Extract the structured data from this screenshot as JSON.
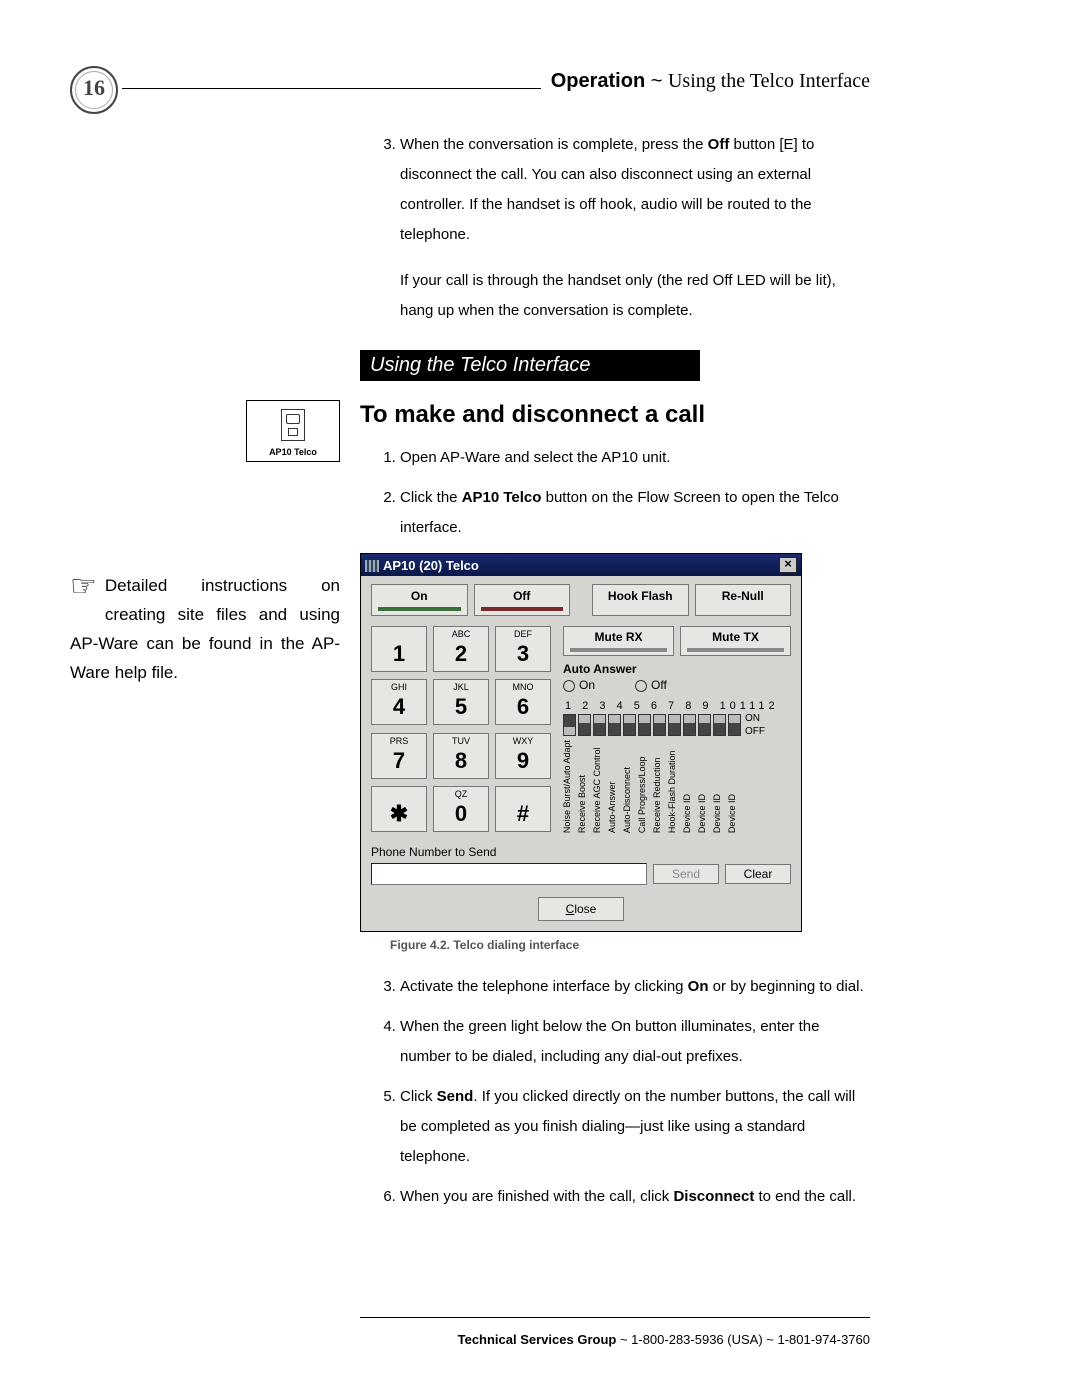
{
  "page_number": "16",
  "header": {
    "bold": "Operation",
    "sep": " ~ ",
    "rest": "Using the Telco Interface"
  },
  "intro": {
    "step3_a": "When the conversation is complete, press the ",
    "step3_bold": "Off",
    "step3_b": " button [E] to disconnect the call. You can also disconnect using an external controller. If the handset is off hook, audio will be routed to the telephone.",
    "step3_c": "If your call is through the handset only (the red Off LED will be lit), hang up when the conversation is complete."
  },
  "section_bar": "Using the Telco Interface",
  "subhead": "To make and disconnect a call",
  "steps_top": {
    "s1": "Open AP-Ware and select the AP10 unit.",
    "s2_a": "Click the ",
    "s2_bold": "AP10 Telco",
    "s2_b": " button on the Flow Screen to open the Telco interface."
  },
  "side_button_label": "AP10 Telco",
  "note": "Detailed instructions on creating site files and using AP-Ware can be found in the AP-Ware help file.",
  "dialog": {
    "title": "AP10 (20) Telco",
    "close_glyph": "×",
    "top_btns": [
      "On",
      "Off",
      "Hook Flash",
      "Re-Null"
    ],
    "mute_btns": [
      "Mute RX",
      "Mute TX"
    ],
    "auto_answer": {
      "title": "Auto Answer",
      "on": "On",
      "off": "Off"
    },
    "keypad": [
      {
        "ltr": "",
        "num": "1"
      },
      {
        "ltr": "ABC",
        "num": "2"
      },
      {
        "ltr": "DEF",
        "num": "3"
      },
      {
        "ltr": "GHI",
        "num": "4"
      },
      {
        "ltr": "JKL",
        "num": "5"
      },
      {
        "ltr": "MNO",
        "num": "6"
      },
      {
        "ltr": "PRS",
        "num": "7"
      },
      {
        "ltr": "TUV",
        "num": "8"
      },
      {
        "ltr": "WXY",
        "num": "9"
      },
      {
        "ltr": "",
        "num": "✱"
      },
      {
        "ltr": "QZ",
        "num": "0"
      },
      {
        "ltr": "",
        "num": "#"
      }
    ],
    "dip": {
      "numbers": "1 2 3 4 5 6 7 8 9 101112",
      "on": "ON",
      "off": "OFF",
      "labels": [
        "Noise Burst/Auto Adapt",
        "Receive Boost",
        "Receive AGC Control",
        "Auto-Answer",
        "Auto-Disconnect",
        "Call Progress/Loop",
        "Receive Reduction",
        "Hook-Flash Duration",
        "Device ID",
        "Device ID",
        "Device ID",
        "Device ID"
      ]
    },
    "pn_label": "Phone Number to Send",
    "send": "Send",
    "clear": "Clear",
    "close": "Close"
  },
  "fig_caption": "Figure 4.2. Telco dialing interface",
  "steps_bottom": {
    "s3_a": "Activate the telephone interface by clicking ",
    "s3_bold": "On",
    "s3_b": " or by beginning to dial.",
    "s4": "When the green light below the On button illuminates, enter the number to be dialed, including any dial-out prefixes.",
    "s5_a": "Click ",
    "s5_bold": "Send",
    "s5_b": ". If you clicked directly on the number buttons, the call will be completed as you finish dialing—just like using a standard telephone.",
    "s6_a": "When you are finished with the call, click ",
    "s6_bold": "Disconnect",
    "s6_b": " to end the call."
  },
  "footer": {
    "bold": "Technical Services Group",
    "rest": " ~ 1-800-283-5936 (USA) ~ 1-801-974-3760"
  }
}
